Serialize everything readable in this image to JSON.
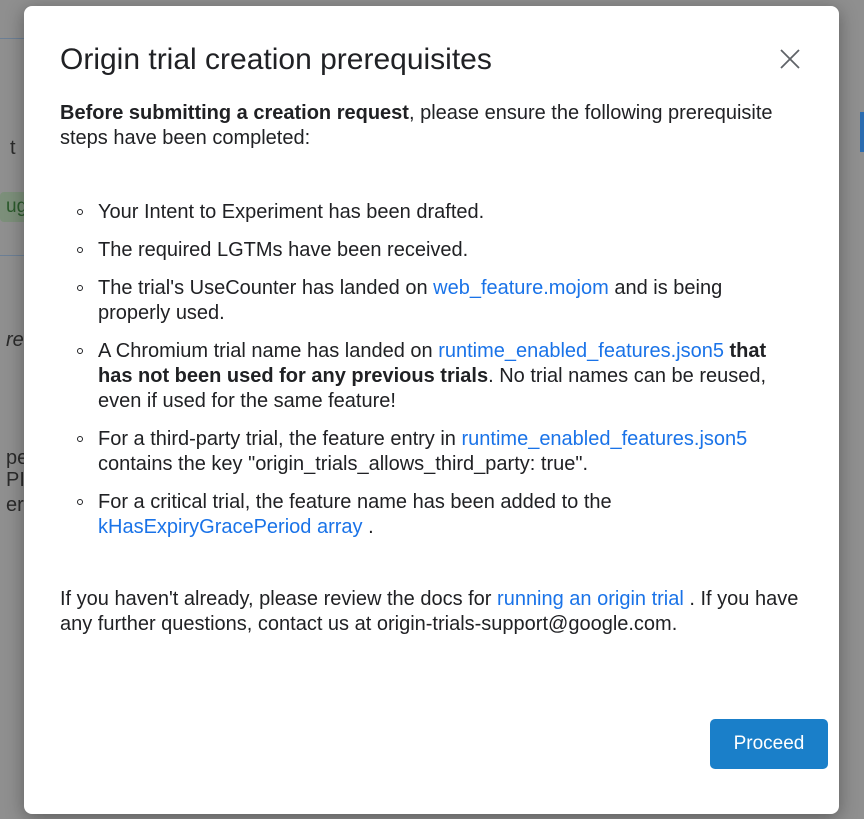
{
  "background": {
    "fragments": [
      "t",
      "ug",
      "re",
      "pe",
      "PI",
      "er"
    ]
  },
  "dialog": {
    "title": "Origin trial creation prerequisites",
    "close_icon": "close-icon",
    "intro_bold": "Before submitting a creation request",
    "intro_rest": ", please ensure the following prerequisite steps have been completed:",
    "items": {
      "i1": {
        "text": "Your Intent to Experiment has been drafted."
      },
      "i2": {
        "text": "The required LGTMs have been received."
      },
      "i3": {
        "pre": "The trial's UseCounter has landed on ",
        "link": "web_feature.mojom",
        "post": " and is being properly used."
      },
      "i4": {
        "pre": "A Chromium trial name has landed on ",
        "link": "runtime_enabled_features.json5",
        "bold": "that has not been used for any previous trials",
        "post": ". No trial names can be reused, even if used for the same feature!"
      },
      "i5": {
        "pre": "For a third-party trial, the feature entry in ",
        "link": "runtime_enabled_features.json5",
        "post": " contains the key \"origin_trials_allows_third_party: true\"."
      },
      "i6": {
        "pre": "For a critical trial, the feature name has been added to the ",
        "link": "kHasExpiryGracePeriod array",
        "post": " ."
      }
    },
    "outro": {
      "pre": "If you haven't already, please review the docs for ",
      "link": "running an origin trial",
      "post": " . If you have any further questions, contact us at origin-trials-support@google.com."
    },
    "proceed_label": "Proceed"
  },
  "colors": {
    "link": "#1a73e8",
    "primary_button": "#1a7fc9",
    "overlay": "#8f8f8f"
  }
}
